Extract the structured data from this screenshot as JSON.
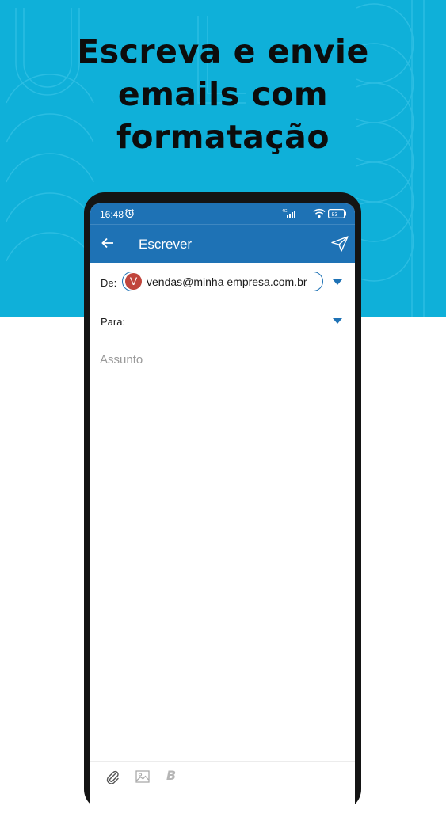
{
  "headline": {
    "line1": "Escreva e envie",
    "line2": "emails com",
    "line3": "formatação"
  },
  "colors": {
    "hero_background": "#0fb0d9",
    "app_bar": "#1e72b5",
    "avatar": "#c0453c",
    "accent": "#1e72b5"
  },
  "status_bar": {
    "time": "16:48",
    "network": "4G",
    "battery": "83",
    "icons": [
      "alarm-icon",
      "signal-icon",
      "wifi-icon",
      "battery-icon"
    ]
  },
  "app_bar": {
    "title": "Escrever",
    "icons": [
      "back-arrow-icon",
      "send-icon"
    ]
  },
  "compose": {
    "from_label": "De:",
    "from_avatar_letter": "V",
    "from_email": "vendas@minha empresa.com.br",
    "to_label": "Para:",
    "to_value": "",
    "subject_placeholder": "Assunto",
    "subject_value": "",
    "body_value": ""
  },
  "toolbar": {
    "icons": [
      "attachment-icon",
      "image-icon",
      "bold-format-icon"
    ],
    "bold_label": "B"
  }
}
